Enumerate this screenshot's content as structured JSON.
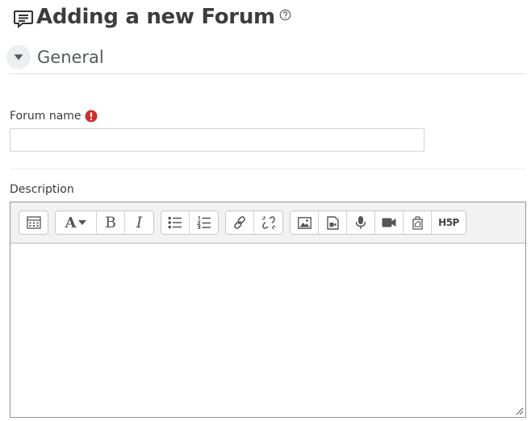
{
  "page": {
    "title": "Adding a new Forum"
  },
  "section": {
    "title": "General"
  },
  "form": {
    "name_label": "Forum name",
    "name_value": "",
    "description_label": "Description"
  },
  "toolbar": {
    "groups": [
      [
        "show-more-icon"
      ],
      [
        "font-style-icon",
        "bold-icon",
        "italic-icon"
      ],
      [
        "unordered-list-icon",
        "ordered-list-icon"
      ],
      [
        "link-icon",
        "unlink-icon"
      ],
      [
        "image-icon",
        "media-icon",
        "record-audio-icon",
        "record-video-icon",
        "manage-files-icon",
        "h5p-icon"
      ]
    ],
    "h5p_text": "H5P",
    "bold_text": "B",
    "italic_text": "I",
    "font_text": "A"
  },
  "colors": {
    "required": "#c9302c",
    "title": "#3d3d3d",
    "border": "#8f959e"
  }
}
